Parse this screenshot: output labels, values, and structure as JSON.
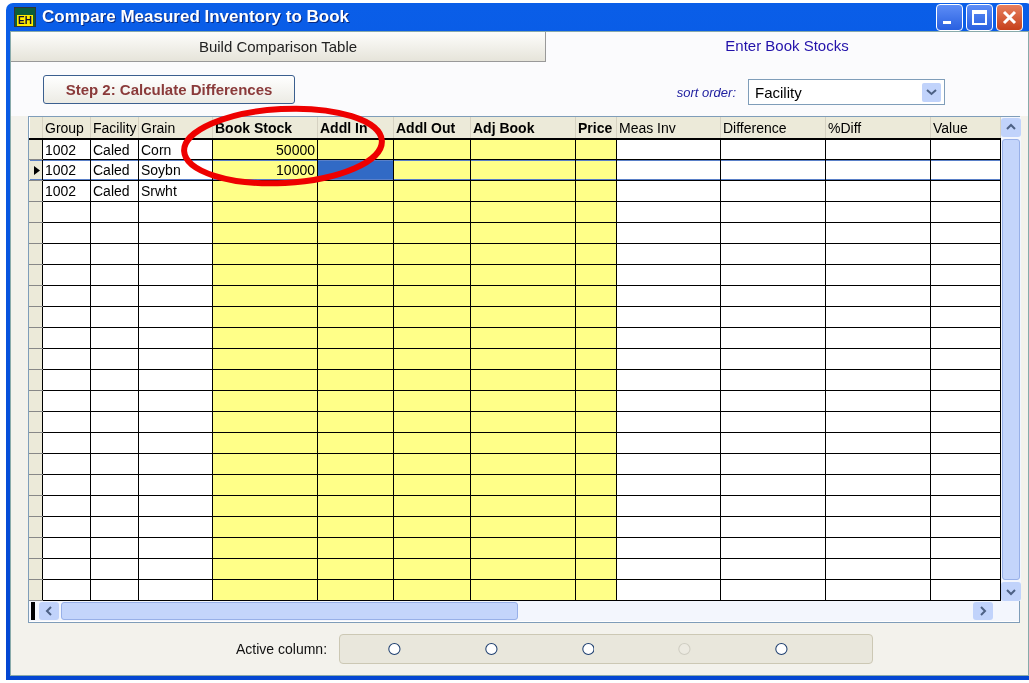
{
  "window": {
    "title": "Compare Measured Inventory to Book",
    "icon_text": "EH"
  },
  "tabs": [
    {
      "label": "Build Comparison Table",
      "selected": false
    },
    {
      "label": "Enter Book Stocks",
      "selected": true
    }
  ],
  "calculate_button": {
    "label": "Step 2: Calculate Differences"
  },
  "sort_order": {
    "label": "sort order:",
    "value": "Facility"
  },
  "grid": {
    "columns": [
      {
        "label": "Group",
        "kind": "text",
        "highlighted": false
      },
      {
        "label": "Facility",
        "kind": "text",
        "highlighted": false
      },
      {
        "label": "Grain",
        "kind": "text",
        "highlighted": false
      },
      {
        "label": "Book Stock",
        "kind": "number",
        "highlighted": true
      },
      {
        "label": "Addl In",
        "kind": "number",
        "highlighted": true
      },
      {
        "label": "Addl Out",
        "kind": "number",
        "highlighted": true
      },
      {
        "label": "Adj Book",
        "kind": "number",
        "highlighted": true
      },
      {
        "label": "Price",
        "kind": "number",
        "highlighted": true
      },
      {
        "label": "Meas Inv",
        "kind": "number",
        "highlighted": false
      },
      {
        "label": "Difference",
        "kind": "number",
        "highlighted": false
      },
      {
        "label": "%Diff",
        "kind": "number",
        "highlighted": false
      },
      {
        "label": "Value",
        "kind": "number",
        "highlighted": false
      }
    ],
    "rows": [
      {
        "selected": false,
        "cells": [
          {
            "text": "1002",
            "active": false
          },
          {
            "text": "Caled",
            "active": false
          },
          {
            "text": "Corn",
            "active": false
          },
          {
            "text": "50000",
            "active": false
          }
        ]
      },
      {
        "selected": true,
        "cells": [
          {
            "text": "1002",
            "active": false
          },
          {
            "text": "Caled",
            "active": false
          },
          {
            "text": "Soybn",
            "active": false
          },
          {
            "text": "10000",
            "active": false
          },
          {
            "active": true
          }
        ]
      },
      {
        "selected": false,
        "cells": [
          {
            "text": "1002",
            "active": false
          },
          {
            "text": "Caled",
            "active": false
          },
          {
            "text": "Srwht",
            "active": false
          }
        ]
      }
    ]
  },
  "active_column": {
    "label": "Active column:",
    "options": [
      {
        "selected": false,
        "disabled": false
      },
      {
        "selected": false,
        "disabled": false
      },
      {
        "selected": false,
        "disabled": false
      },
      {
        "selected": false,
        "disabled": true
      },
      {
        "selected": false,
        "disabled": false
      }
    ]
  },
  "annotation": {
    "kind": "ellipse"
  }
}
